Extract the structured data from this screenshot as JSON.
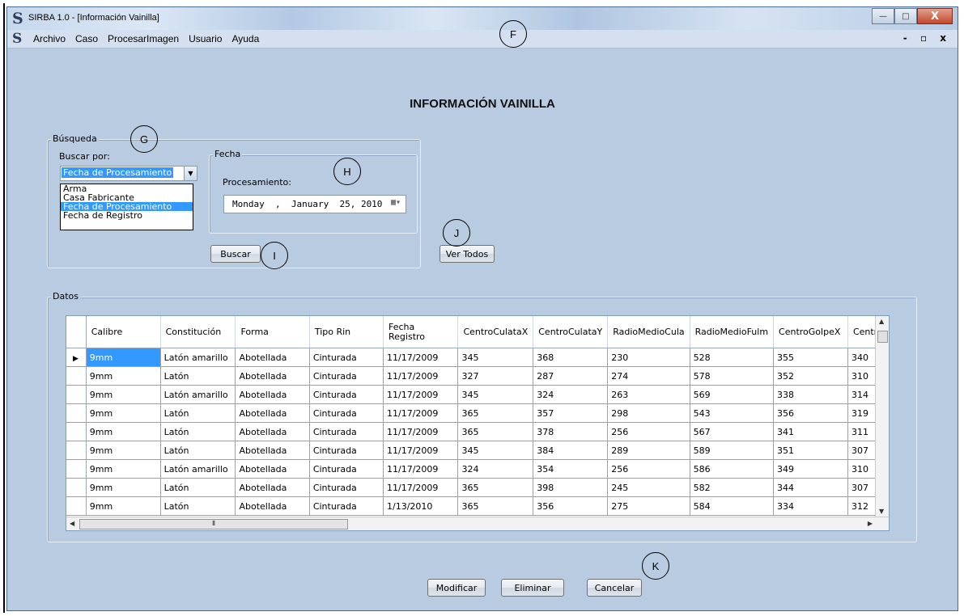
{
  "window": {
    "title": "SIRBA 1.0 - [Información Vainilla]",
    "logo": "S",
    "controls": [
      "minimize-icon",
      "maximize-icon",
      "close-icon"
    ],
    "close_glyph": "X",
    "min_glyph": "—",
    "max_glyph": "□"
  },
  "menubar": {
    "logo": "S",
    "items": [
      "Archivo",
      "Caso",
      "ProcesarImagen",
      "Usuario",
      "Ayuda"
    ],
    "mdi_controls": "- ▫ x"
  },
  "page_title": "INFORMACIÓN VAINILLA",
  "busqueda": {
    "legend": "Búsqueda",
    "buscar_por_label": "Buscar por:",
    "selected": "Fecha de Procesamiento",
    "options": [
      "Arma",
      "Casa Fabricante",
      "Fecha de Procesamiento",
      "Fecha de Registro"
    ],
    "fecha": {
      "legend": "Fecha",
      "procesamiento_label": "Procesamiento:",
      "date_value": "Monday  ,  January  25, 2010"
    },
    "buscar_button": "Buscar"
  },
  "ver_todos_button": "Ver Todos",
  "datos": {
    "legend": "Datos",
    "columns": [
      "Calibre",
      "Constitución",
      "Forma",
      "Tipo Rin",
      "Fecha Registro",
      "CentroCulataX",
      "CentroCulataY",
      "RadioMedioCula",
      "RadioMedioFulm",
      "CentroGolpeX",
      "Centro"
    ],
    "rows": [
      [
        "9mm",
        "Latón amarillo",
        "Abotellada",
        "Cinturada",
        "11/17/2009",
        "345",
        "368",
        "230",
        "528",
        "355",
        "340"
      ],
      [
        "9mm",
        "Latón",
        "Abotellada",
        "Cinturada",
        "11/17/2009",
        "327",
        "287",
        "274",
        "578",
        "352",
        "310"
      ],
      [
        "9mm",
        "Latón amarillo",
        "Abotellada",
        "Cinturada",
        "11/17/2009",
        "345",
        "324",
        "263",
        "569",
        "338",
        "314"
      ],
      [
        "9mm",
        "Latón",
        "Abotellada",
        "Cinturada",
        "11/17/2009",
        "365",
        "357",
        "298",
        "543",
        "356",
        "319"
      ],
      [
        "9mm",
        "Latón",
        "Abotellada",
        "Cinturada",
        "11/17/2009",
        "365",
        "378",
        "256",
        "567",
        "341",
        "311"
      ],
      [
        "9mm",
        "Latón",
        "Abotellada",
        "Cinturada",
        "11/17/2009",
        "345",
        "384",
        "289",
        "589",
        "351",
        "307"
      ],
      [
        "9mm",
        "Latón amarillo",
        "Abotellada",
        "Cinturada",
        "11/17/2009",
        "324",
        "354",
        "256",
        "586",
        "349",
        "310"
      ],
      [
        "9mm",
        "Latón",
        "Abotellada",
        "Cinturada",
        "11/17/2009",
        "365",
        "398",
        "245",
        "582",
        "344",
        "307"
      ],
      [
        "9mm",
        "Latón",
        "Abotellada",
        "Cinturada",
        "1/13/2010",
        "365",
        "356",
        "275",
        "584",
        "334",
        "312"
      ]
    ],
    "selected_row": 0
  },
  "actions": {
    "modificar": "Modificar",
    "eliminar": "Eliminar",
    "cancelar": "Cancelar"
  },
  "callouts": [
    "F",
    "G",
    "H",
    "I",
    "J",
    "K"
  ]
}
